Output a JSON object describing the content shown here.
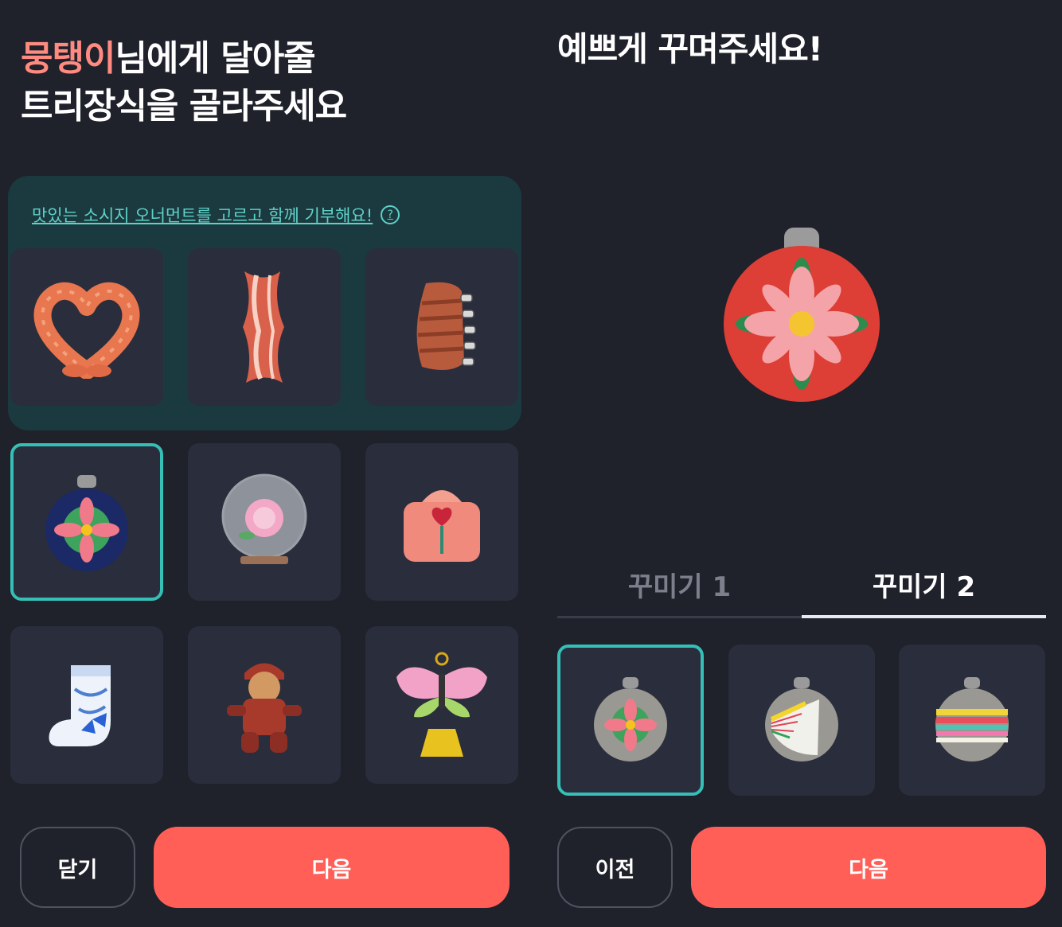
{
  "left": {
    "title_name": "뭉탱이",
    "title_line1_rest": "님에게 달아줄",
    "title_line2": "트리장식을 골라주세요",
    "promo_text": "맛있는 소시지 오너먼트를 고르고 함께 기부해요!",
    "help_glyph": "?",
    "items": [
      {
        "icon": "heart-sausage-icon"
      },
      {
        "icon": "bacon-icon"
      },
      {
        "icon": "ribs-icon"
      },
      {
        "icon": "navy-flower-ornament-icon",
        "selected": true
      },
      {
        "icon": "peony-snowglobe-icon"
      },
      {
        "icon": "bojagi-gift-icon"
      },
      {
        "icon": "blue-sock-icon"
      },
      {
        "icon": "gingerbread-icon"
      },
      {
        "icon": "butterfly-norigae-icon"
      }
    ],
    "close_label": "닫기",
    "next_label": "다음"
  },
  "right": {
    "title": "예쁘게 꾸며주세요!",
    "preview_icon": "red-flower-ornament-icon",
    "tabs": [
      {
        "label": "꾸미기 1",
        "active": false
      },
      {
        "label": "꾸미기 2",
        "active": true
      }
    ],
    "patterns": [
      {
        "icon": "flower-pattern-icon",
        "selected": true
      },
      {
        "icon": "fan-pattern-icon"
      },
      {
        "icon": "stripe-pattern-icon"
      }
    ],
    "prev_label": "이전",
    "next_label": "다음"
  },
  "colors": {
    "background": "#1f212b",
    "accent_red": "#ff5f57",
    "highlight_pink": "#ff8a80",
    "teal": "#35bfb6"
  }
}
